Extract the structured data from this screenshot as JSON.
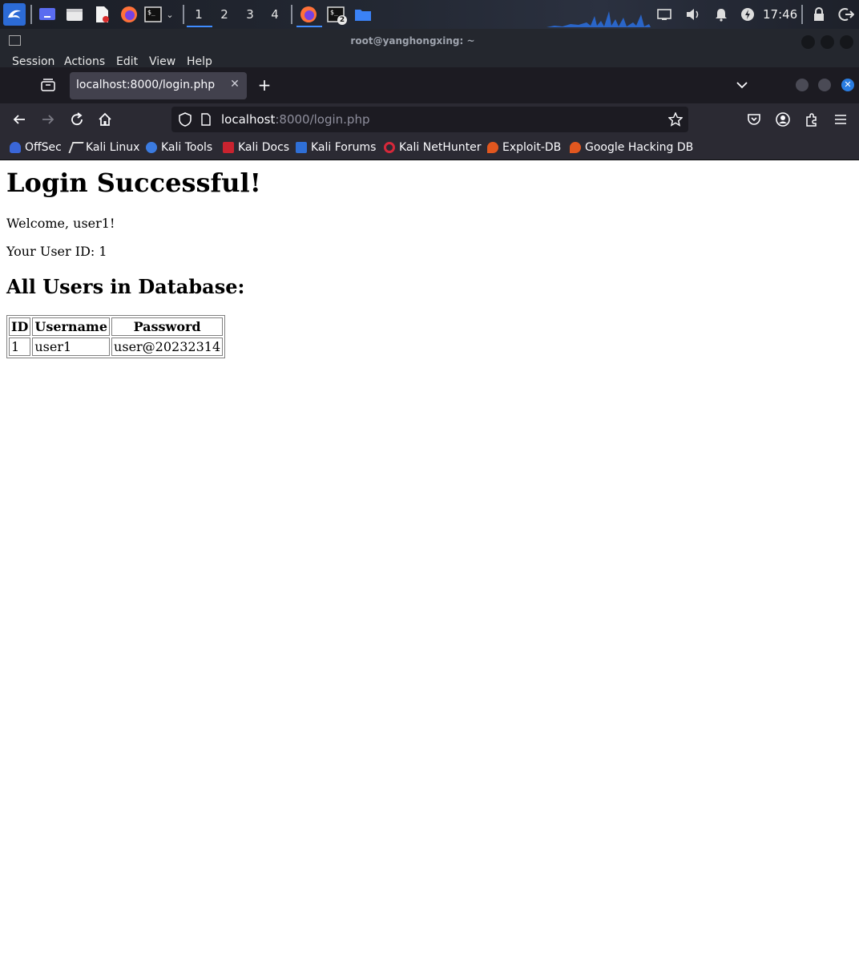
{
  "taskbar": {
    "workspaces": [
      "1",
      "2",
      "3",
      "4"
    ],
    "active_workspace": "1",
    "terminal_badge": "2",
    "clock": "17:46",
    "icons": [
      "kali-dragon-icon",
      "desktop-icon",
      "file-manager-icon",
      "text-editor-icon",
      "firefox-icon",
      "terminal-icon",
      "chevron-down-icon",
      "firefox-icon",
      "terminal-icon",
      "folder-icon",
      "display-icon",
      "volume-icon",
      "bell-icon",
      "power-icon",
      "lock-icon",
      "logout-icon"
    ],
    "accent": "#3f8cff"
  },
  "terminal": {
    "title": "root@yanghongxing: ~",
    "menu": [
      "Session",
      "Actions",
      "Edit",
      "View",
      "Help"
    ]
  },
  "browser": {
    "tab_title": "localhost:8000/login.php",
    "url_host": "localhost",
    "url_path": ":8000/login.php",
    "bookmarks": [
      "OffSec",
      "Kali Linux",
      "Kali Tools",
      "Kali Docs",
      "Kali Forums",
      "Kali NetHunter",
      "Exploit-DB",
      "Google Hacking DB"
    ]
  },
  "page": {
    "heading": "Login Successful!",
    "welcome": "Welcome, user1!",
    "user_id_line": "Your User ID: 1",
    "subheading": "All Users in Database:",
    "table": {
      "headers": [
        "ID",
        "Username",
        "Password"
      ],
      "rows": [
        [
          "1",
          "user1",
          "user@20232314"
        ]
      ]
    }
  }
}
